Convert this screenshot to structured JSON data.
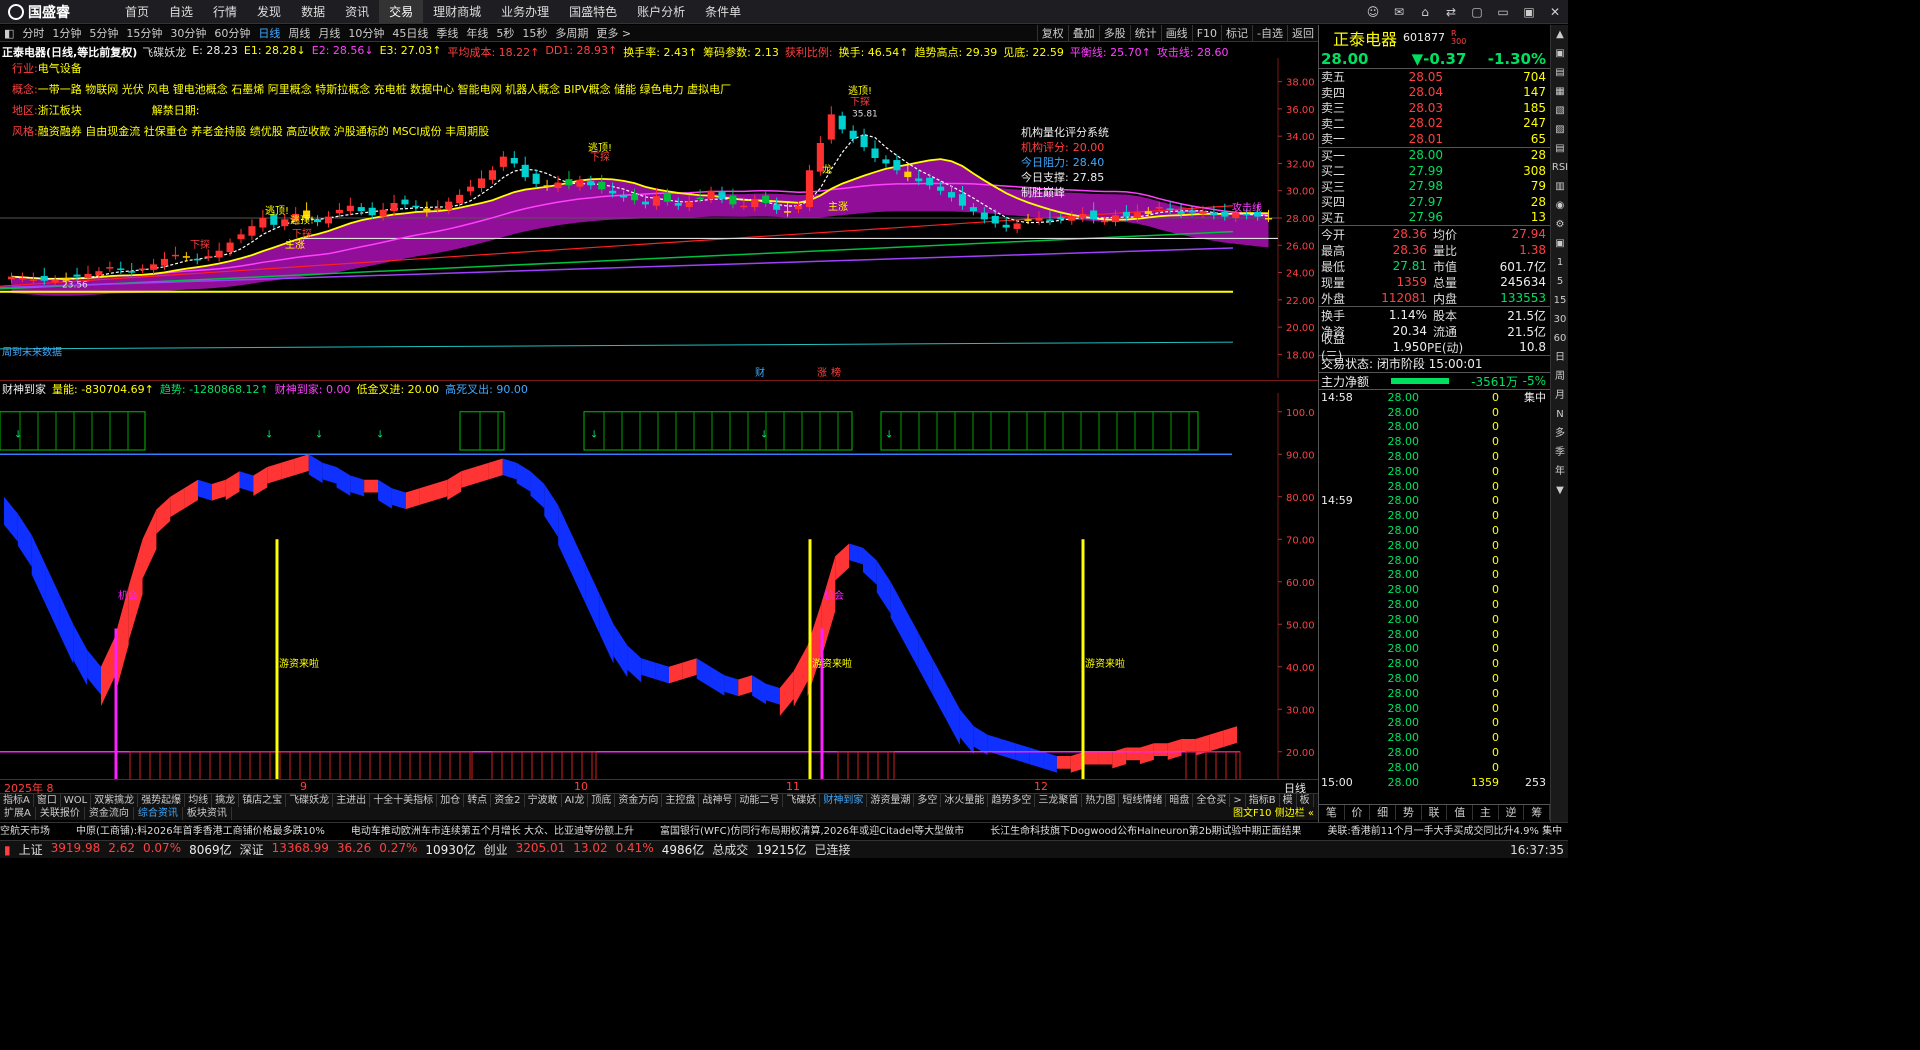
{
  "app": {
    "logo": "国盛睿",
    "menu": [
      "首页",
      "自选",
      "行情",
      "发现",
      "数据",
      "资讯",
      "交易",
      "理财商城",
      "业务办理",
      "国盛特色",
      "账户分析",
      "条件单"
    ],
    "active_menu": 6,
    "window_controls": [
      "☺",
      "✉",
      "⌂",
      "⇄",
      "▢",
      "▭",
      "▣",
      "✕"
    ]
  },
  "period_bar": {
    "items": [
      "分时",
      "1分钟",
      "5分钟",
      "15分钟",
      "30分钟",
      "60分钟",
      "日线",
      "周线",
      "月线",
      "10分钟",
      "45日线",
      "季线",
      "年线",
      "5秒",
      "15秒",
      "多周期",
      "更多 >"
    ],
    "selected": 6,
    "tools": [
      "复权",
      "叠加",
      "多股",
      "统计",
      "画线",
      "F10",
      "标记",
      "-自选",
      "返回"
    ]
  },
  "main_info": {
    "title": "正泰电器(日线,等比前复权)",
    "items": [
      {
        "t": "飞碟妖龙",
        "c": "#ddd"
      },
      {
        "t": "E: 28.23",
        "c": "#eee"
      },
      {
        "t": "E1: 28.28↓",
        "c": "#ffff00"
      },
      {
        "t": "E2: 28.56↓",
        "c": "#ff40ff"
      },
      {
        "t": "E3: 27.03↑",
        "c": "#ffff00"
      },
      {
        "t": "平均成本: 18.22↑",
        "c": "#ff4040"
      },
      {
        "t": "DD1: 28.93↑",
        "c": "#ff4040"
      },
      {
        "t": "换手率: 2.43↑",
        "c": "#ffff00"
      },
      {
        "t": "筹码参数: 2.13",
        "c": "#ffff00"
      },
      {
        "t": "获利比例: ",
        "c": "#ff4040"
      },
      {
        "t": "换手: 46.54↑",
        "c": "#ffff00"
      },
      {
        "t": "趋势高点: 29.39",
        "c": "#ffff00"
      },
      {
        "t": "见底: 22.59",
        "c": "#ffff00"
      },
      {
        "t": "平衡线: 25.70↑",
        "c": "#ff40ff"
      },
      {
        "t": "攻击线: 28.60",
        "c": "#ff40ff"
      }
    ]
  },
  "concepts": {
    "industry_label": "行业:",
    "industry": "电气设备",
    "concept_label": "概念:",
    "concept": "一带一路 物联网 光伏 风电 锂电池概念 石墨烯 阿里概念 特斯拉概念 充电桩 数据中心 智能电网 机器人概念 BIPV概念 储能 绿色电力 虚拟电厂",
    "region_label": "地区:",
    "region": "浙江板块",
    "unlock_label": "解禁日期:",
    "style_label": "风格:",
    "style": "融资融券 自由现金流 社保重仓 养老金持股 绩优股 高应收款 沪股通标的 MSCI成份 丰周期股"
  },
  "score_panel": {
    "title": "机构量化评分系统",
    "items": [
      {
        "label": "机构评分:",
        "value": "20.00",
        "c": "#ff4040"
      },
      {
        "label": "今日阻力:",
        "value": "28.40",
        "c": "#3fa9ff"
      },
      {
        "label": "今日支撑:",
        "value": "27.85",
        "c": "#eee"
      }
    ],
    "footer": "制胜巅峰"
  },
  "price_axis": [
    "38.00",
    "36.00",
    "34.00",
    "32.00",
    "30.00",
    "28.00",
    "26.00",
    "24.00",
    "22.00",
    "20.00",
    "18.00"
  ],
  "main_annotations": {
    "low_label": "23.56",
    "peak_label": "35.81",
    "attack_line": "攻击线",
    "signals": [
      "下探",
      "逃顶!",
      "下探",
      "逃顶!",
      "下探",
      "逃顶!",
      "下探",
      "主涨",
      "主涨",
      "龙"
    ],
    "future_data": "周到未来数据",
    "cai": "财",
    "zhang": "涨",
    "bang": "榜"
  },
  "sub_info": {
    "title": "财神到家",
    "items": [
      {
        "t": "量能: -830704.69↑",
        "c": "#ffff00"
      },
      {
        "t": "趋势: -1280868.12↑",
        "c": "#00e060"
      },
      {
        "t": "财神到家: 0.00",
        "c": "#ff40ff"
      },
      {
        "t": "低金叉进: 20.00",
        "c": "#ffff00"
      },
      {
        "t": "高死叉出: 90.00",
        "c": "#3fa9ff"
      }
    ]
  },
  "sub_axis": [
    "100.0",
    "90.00",
    "80.00",
    "70.00",
    "60.00",
    "50.00",
    "40.00",
    "30.00",
    "20.00"
  ],
  "sub_annotations": {
    "jihui": "机会",
    "youzi": "游资来啦"
  },
  "date_axis": {
    "labels": [
      "2025年 8",
      "9",
      "10",
      "11",
      "12"
    ],
    "right": "日线"
  },
  "tabs1": [
    "指标A",
    "窗口",
    "WOL",
    "双紫擒龙",
    "强势起爆",
    "均线",
    "擒龙",
    "镇店之宝",
    "飞碟妖龙",
    "主进出",
    "十全十美指标",
    "加仓",
    "转点",
    "资金2",
    "宁波敢",
    "AI龙",
    "顶底",
    "资金方向",
    "主控盘",
    "战神号",
    "动能二号",
    "飞碟妖",
    "财神到家",
    "游资量潮",
    "多空",
    "冰火量能",
    "趋势多空",
    "三龙聚首",
    "热力图",
    "短线情绪",
    "暗盘",
    "全仓买",
    ">",
    "指标B",
    "模",
    "板"
  ],
  "tabs1_selected": 22,
  "tabs2": [
    "扩展A",
    "关联报价",
    "资金流向",
    "综合资讯",
    "板块资讯"
  ],
  "tabs2_selected": 3,
  "tabs2_right": "图文F10 侧边栏 «",
  "quote": {
    "name": "正泰电器",
    "code": "601877",
    "tag": "R\n300",
    "price": "28.00",
    "change": "▼-0.37",
    "pct": "-1.30%",
    "asks": [
      {
        "l": "卖五",
        "p": "28.05",
        "v": "704"
      },
      {
        "l": "卖四",
        "p": "28.04",
        "v": "147"
      },
      {
        "l": "卖三",
        "p": "28.03",
        "v": "185"
      },
      {
        "l": "卖二",
        "p": "28.02",
        "v": "247"
      },
      {
        "l": "卖一",
        "p": "28.01",
        "v": "65"
      }
    ],
    "bids": [
      {
        "l": "买一",
        "p": "28.00",
        "v": "28"
      },
      {
        "l": "买二",
        "p": "27.99",
        "v": "308"
      },
      {
        "l": "买三",
        "p": "27.98",
        "v": "79"
      },
      {
        "l": "买四",
        "p": "27.97",
        "v": "28"
      },
      {
        "l": "买五",
        "p": "27.96",
        "v": "13"
      }
    ],
    "stats": [
      [
        "今开",
        "28.36",
        "up",
        "均价",
        "27.94",
        "up"
      ],
      [
        "最高",
        "28.36",
        "up",
        "量比",
        "1.38",
        "up"
      ],
      [
        "最低",
        "27.81",
        "dn",
        "市值",
        "601.7亿",
        "wh"
      ],
      [
        "现量",
        "1359",
        "up",
        "总量",
        "245634",
        "wh"
      ],
      [
        "外盘",
        "112081",
        "up",
        "内盘",
        "133553",
        "dn"
      ]
    ],
    "stats2": [
      [
        "换手",
        "1.14%",
        "wh",
        "股本",
        "21.5亿",
        "wh"
      ],
      [
        "净资",
        "20.34",
        "wh",
        "流通",
        "21.5亿",
        "wh"
      ],
      [
        "收益(三)",
        "1.950",
        "wh",
        "PE(动)",
        "10.8",
        "wh"
      ]
    ],
    "trade_state": "交易状态: 闭市阶段 15:00:01",
    "net_label": "主力净额",
    "net_value": "-3561万",
    "net_pct": "-5%",
    "ticks": [
      {
        "t": "14:58",
        "p": "28.00",
        "v": "0",
        "f": "集中"
      },
      {
        "t": "",
        "p": "28.00",
        "v": "0",
        "f": ""
      },
      {
        "t": "",
        "p": "28.00",
        "v": "0",
        "f": ""
      },
      {
        "t": "",
        "p": "28.00",
        "v": "0",
        "f": ""
      },
      {
        "t": "",
        "p": "28.00",
        "v": "0",
        "f": ""
      },
      {
        "t": "",
        "p": "28.00",
        "v": "0",
        "f": ""
      },
      {
        "t": "",
        "p": "28.00",
        "v": "0",
        "f": ""
      },
      {
        "t": "14:59",
        "p": "28.00",
        "v": "0",
        "f": ""
      },
      {
        "t": "",
        "p": "28.00",
        "v": "0",
        "f": ""
      },
      {
        "t": "",
        "p": "28.00",
        "v": "0",
        "f": ""
      },
      {
        "t": "",
        "p": "28.00",
        "v": "0",
        "f": ""
      },
      {
        "t": "",
        "p": "28.00",
        "v": "0",
        "f": ""
      },
      {
        "t": "",
        "p": "28.00",
        "v": "0",
        "f": ""
      },
      {
        "t": "",
        "p": "28.00",
        "v": "0",
        "f": ""
      },
      {
        "t": "",
        "p": "28.00",
        "v": "0",
        "f": ""
      },
      {
        "t": "",
        "p": "28.00",
        "v": "0",
        "f": ""
      },
      {
        "t": "",
        "p": "28.00",
        "v": "0",
        "f": ""
      },
      {
        "t": "",
        "p": "28.00",
        "v": "0",
        "f": ""
      },
      {
        "t": "",
        "p": "28.00",
        "v": "0",
        "f": ""
      },
      {
        "t": "",
        "p": "28.00",
        "v": "0",
        "f": ""
      },
      {
        "t": "",
        "p": "28.00",
        "v": "0",
        "f": ""
      },
      {
        "t": "",
        "p": "28.00",
        "v": "0",
        "f": ""
      },
      {
        "t": "",
        "p": "28.00",
        "v": "0",
        "f": ""
      },
      {
        "t": "",
        "p": "28.00",
        "v": "0",
        "f": ""
      },
      {
        "t": "",
        "p": "28.00",
        "v": "0",
        "f": ""
      },
      {
        "t": "",
        "p": "28.00",
        "v": "0",
        "f": ""
      },
      {
        "t": "15:00",
        "p": "28.00",
        "v": "1359",
        "f": "253"
      }
    ],
    "bottom_tabs": [
      "笔",
      "价",
      "细",
      "势",
      "联",
      "值",
      "主",
      "逆",
      "筹"
    ]
  },
  "side_strip": [
    "▲",
    "▣",
    "▤",
    "▦",
    "▧",
    "▨",
    "▤",
    "RSI",
    "▥",
    "◉",
    "⚙",
    "▣",
    "1",
    "5",
    "15",
    "30",
    "60",
    "日",
    "周",
    "月",
    "N",
    "多",
    "季",
    "年",
    "▼"
  ],
  "ticker": [
    "空航天市场",
    "中原(工商铺):料2026年首季香港工商铺价格最多跌10%",
    "电动车推动欧洲车市连续第五个月增长 大众、比亚迪等份额上升",
    "富国银行(WFC)仿同行布局期权清算,2026年或迎Citadel等大型做市",
    "长江生命科技旗下Dogwood公布Halneuron第2b期试验中期正面结果",
    "美联:香港前11个月一手大手买成交同比升4.9% 集中"
  ],
  "status": [
    {
      "t": "上证",
      "c": "#ddd"
    },
    {
      "t": "3919.98",
      "c": "#ff4040"
    },
    {
      "t": "2.62",
      "c": "#ff4040"
    },
    {
      "t": "0.07%",
      "c": "#ff4040"
    },
    {
      "t": "8069亿",
      "c": "#eee"
    },
    {
      "t": "深证",
      "c": "#ddd"
    },
    {
      "t": "13368.99",
      "c": "#ff4040"
    },
    {
      "t": "36.26",
      "c": "#ff4040"
    },
    {
      "t": "0.27%",
      "c": "#ff4040"
    },
    {
      "t": "10930亿",
      "c": "#eee"
    },
    {
      "t": "创业",
      "c": "#ddd"
    },
    {
      "t": "3205.01",
      "c": "#ff4040"
    },
    {
      "t": "13.02",
      "c": "#ff4040"
    },
    {
      "t": "0.41%",
      "c": "#ff4040"
    },
    {
      "t": "4986亿",
      "c": "#eee"
    },
    {
      "t": "总成交",
      "c": "#ddd"
    },
    {
      "t": "19215亿",
      "c": "#eee"
    },
    {
      "t": "已连接",
      "c": "#ddd"
    }
  ],
  "clock": "16:37:35",
  "chart_data": [
    {
      "type": "candlestick",
      "title": "正泰电器(日线,等比前复权)",
      "ylim": [
        17,
        39
      ],
      "y_ticks": [
        18,
        20,
        22,
        24,
        26,
        28,
        30,
        32,
        34,
        36,
        38
      ],
      "x_labels": [
        "2025年 8",
        "9",
        "10",
        "11",
        "12"
      ],
      "close": [
        23.7,
        23.6,
        23.5,
        23.4,
        23.5,
        23.6,
        23.7,
        23.9,
        24.1,
        24.4,
        24.2,
        24.0,
        24.3,
        24.6,
        25.0,
        25.3,
        25.1,
        24.9,
        25.2,
        25.6,
        26.2,
        26.8,
        27.4,
        28.0,
        27.5,
        27.9,
        28.3,
        28.0,
        27.7,
        28.1,
        28.6,
        28.9,
        28.5,
        28.2,
        28.6,
        29.1,
        29.0,
        28.8,
        28.4,
        28.7,
        29.2,
        29.7,
        30.3,
        30.9,
        31.5,
        32.5,
        32.0,
        31.0,
        30.5,
        30.3,
        30.6,
        30.4,
        30.8,
        30.4,
        30.1,
        29.8,
        29.5,
        29.3,
        29.0,
        29.6,
        29.2,
        28.9,
        29.2,
        29.5,
        30.0,
        29.4,
        29.0,
        28.9,
        29.4,
        29.1,
        28.6,
        28.4,
        28.9,
        31.5,
        33.5,
        35.6,
        34.5,
        33.8,
        33.2,
        32.4,
        32.0,
        31.5,
        31.0,
        30.7,
        30.4,
        30.0,
        29.5,
        28.9,
        28.5,
        27.9,
        27.6,
        27.3,
        27.6,
        27.9,
        28.0,
        27.8,
        27.9,
        28.1,
        28.3,
        27.9,
        27.8,
        28.2,
        28.1,
        28.4,
        28.5,
        28.8,
        28.6,
        28.3,
        28.4,
        28.5,
        28.2,
        28.1,
        28.4,
        28.2,
        28.1,
        28.0
      ],
      "lines": [
        {
          "name": "平衡线",
          "color": "#ff40ff"
        },
        {
          "name": "攻击线",
          "color": "#ff40ff"
        }
      ],
      "reference_levels": [
        22.59,
        28.6
      ]
    },
    {
      "type": "area",
      "title": "财神到家",
      "ylim": [
        15,
        103
      ],
      "y_ticks": [
        20,
        30,
        40,
        50,
        60,
        70,
        80,
        90,
        100
      ],
      "values": [
        80,
        76,
        71,
        64,
        57,
        50,
        44,
        40,
        47,
        59,
        70,
        77,
        80,
        82,
        84,
        83,
        84,
        86,
        85,
        87,
        88,
        89,
        90,
        88,
        87,
        85,
        84,
        84,
        82,
        81,
        82,
        83,
        84,
        86,
        87,
        88,
        89,
        88,
        86,
        83,
        78,
        71,
        64,
        57,
        50,
        45,
        42,
        41,
        40,
        41,
        42,
        40,
        38,
        37,
        38,
        36,
        35,
        39,
        45,
        55,
        66,
        69,
        68,
        65,
        60,
        54,
        48,
        42,
        36,
        30,
        26,
        24,
        23,
        22,
        21,
        20,
        19,
        19,
        20,
        20,
        20,
        21,
        21,
        22,
        22,
        23,
        23,
        24,
        25,
        26
      ],
      "thresholds": {
        "low": 20,
        "high": 90
      }
    }
  ]
}
